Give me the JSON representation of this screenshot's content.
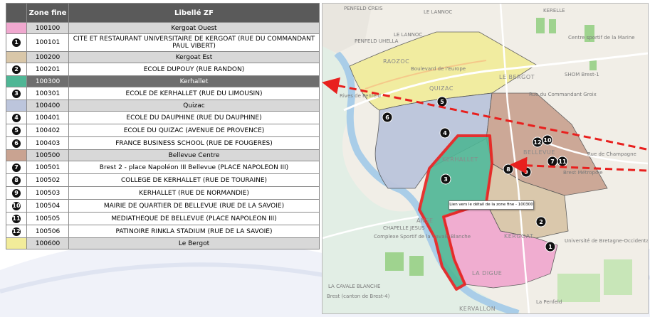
{
  "table": {
    "header_zone": "Zone fine",
    "header_label": "Libellé ZF",
    "rows": [
      {
        "kind": "zone",
        "color": "#f0a8cf",
        "code": "100100",
        "label": "Kergoat Ouest"
      },
      {
        "kind": "site",
        "marker": "1",
        "code": "100101",
        "label": "CITE ET RESTAURANT UNIVERSITAIRE DE KERGOAT (RUE DU COMMANDANT PAUL VIBERT)"
      },
      {
        "kind": "zone",
        "color": "#d9c7a9",
        "code": "100200",
        "label": "Kergoat Est"
      },
      {
        "kind": "site",
        "marker": "2",
        "code": "100201",
        "label": "ECOLE DUPOUY (RUE RANDON)"
      },
      {
        "kind": "zone",
        "color": "#4fb695",
        "code": "100300",
        "label": "Kerhallet",
        "highlight": true
      },
      {
        "kind": "site",
        "marker": "3",
        "code": "100301",
        "label": "ECOLE DE KERHALLET (RUE DU LIMOUSIN)"
      },
      {
        "kind": "zone",
        "color": "#bcc5dc",
        "code": "100400",
        "label": "Quizac"
      },
      {
        "kind": "site",
        "marker": "4",
        "code": "100401",
        "label": "ECOLE DU DAUPHINE (RUE DU DAUPHINE)"
      },
      {
        "kind": "site",
        "marker": "5",
        "code": "100402",
        "label": "ECOLE DU QUIZAC (AVENUE DE PROVENCE)"
      },
      {
        "kind": "site",
        "marker": "6",
        "code": "100403",
        "label": "FRANCE BUSINESS SCHOOL (RUE DE FOUGERES)"
      },
      {
        "kind": "zone",
        "color": "#c9a391",
        "code": "100500",
        "label": "Bellevue Centre"
      },
      {
        "kind": "site",
        "marker": "7",
        "code": "100501",
        "label": "Brest 2 - place Napoléon III Bellevue (PLACE NAPOLEON III)"
      },
      {
        "kind": "site",
        "marker": "8",
        "code": "100502",
        "label": "COLLEGE DE KERHALLET (RUE DE TOURAINE)"
      },
      {
        "kind": "site",
        "marker": "9",
        "code": "100503",
        "label": "KERHALLET (RUE DE NORMANDIE)"
      },
      {
        "kind": "site",
        "marker": "10",
        "code": "100504",
        "label": "MAIRIE DE QUARTIER DE BELLEVUE (RUE DE LA SAVOIE)"
      },
      {
        "kind": "site",
        "marker": "11",
        "code": "100505",
        "label": "MEDIATHEQUE DE BELLEVUE (PLACE NAPOLEON III)"
      },
      {
        "kind": "site",
        "marker": "12",
        "code": "100506",
        "label": "PATINOIRE RINKLA STADIUM (RUE DE LA SAVOIE)"
      },
      {
        "kind": "zone",
        "color": "#f2ec9a",
        "code": "100600",
        "label": "Le Bergot"
      }
    ]
  },
  "map": {
    "tooltip": "Lien vers le détail de la zone fine - 100300",
    "labels": {
      "penfeld_crest": "PENFELD CREIS",
      "le_lannoc_top": "LE LANNOC",
      "kerelle": "KERELLE",
      "centre_sportif": "Centre sportif de la Marine",
      "penfeld_uhella": "PENFELD UHELLA",
      "le_lannoc": "LE LANNOC",
      "raozoc": "RAOZOC",
      "quizac": "QUIZAC",
      "le_bergot": "LE BERGOT",
      "shom": "SHOM Brest-1",
      "rives_penfeld": "Rives de Penfeld",
      "kerhallet": "KERHALLET",
      "bellevue": "BELLEVUE",
      "brest_metropole": "Brest Métropole",
      "anse_kervallon": "ANSE",
      "chapelle_jesus": "CHAPELLE JESUS",
      "complexe_sportif": "Complexe Sportif de la Cavale Blanche",
      "kergoat": "KERGOAT",
      "universite": "Université de Bretagne-Occidentale",
      "la_digue": "LA DIGUE",
      "la_cavale_blanche": "LA CAVALE BLANCHE",
      "brest_canton": "Brest (canton de Brest-4)",
      "kervallon": "KERVALLON",
      "la_penfeld": "La Penfeld",
      "rue_champagne": "Rue de Champagne",
      "bd_europe": "Boulevard de l'Europe",
      "rue_commandant": "Rue du Commandant Groix"
    }
  },
  "colors": {
    "pink": "#f0a8cf",
    "tan": "#d9c7a9",
    "green": "#4fb695",
    "blue": "#bcc5dc",
    "brown": "#c9a391",
    "yellow": "#f2ec9a",
    "arrow": "#e8201e"
  }
}
